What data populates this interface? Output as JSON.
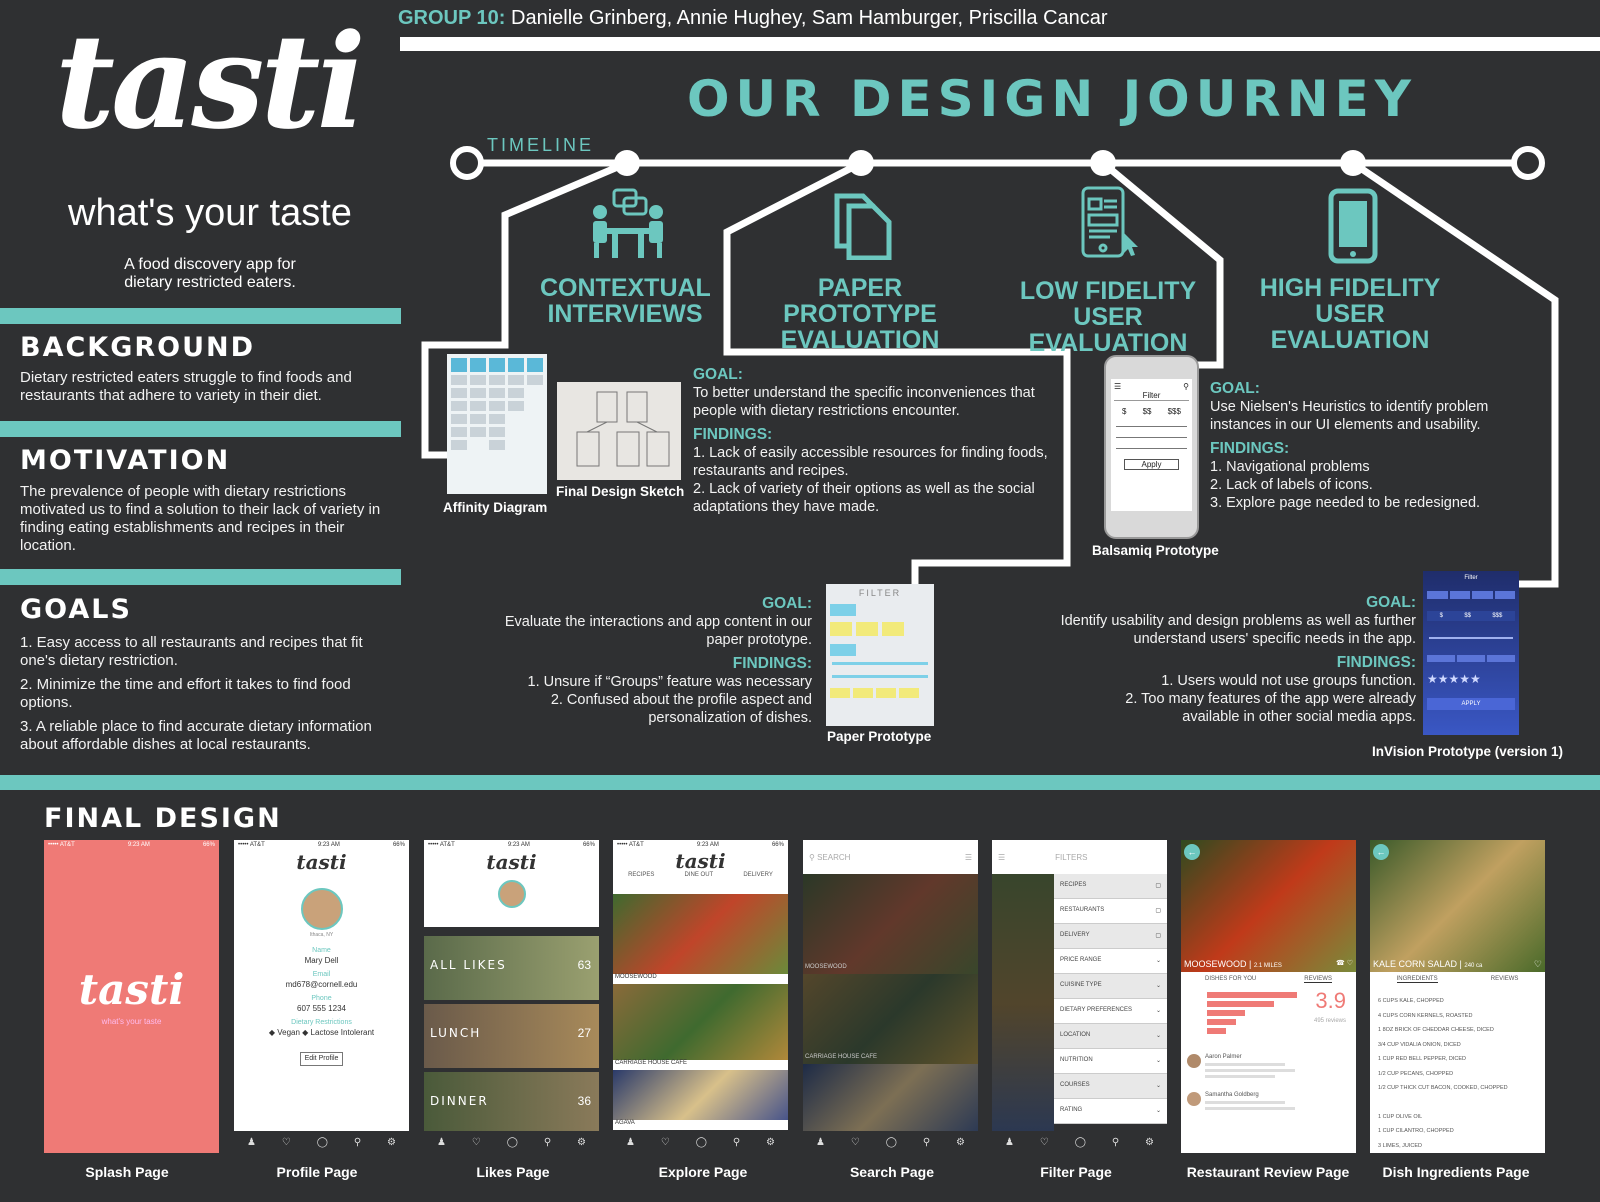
{
  "header": {
    "group_label": "GROUP 10:",
    "members": "Danielle Grinberg, Annie Hughey, Sam Hamburger, Priscilla Cancar"
  },
  "brand": {
    "logo": "tasti",
    "tagline": "what's your taste",
    "desc_line1": "A food discovery app for",
    "desc_line2": "dietary restricted eaters."
  },
  "background": {
    "title": "BACKGROUND",
    "text": "Dietary restricted eaters struggle to find foods and restaurants that adhere to variety in their diet."
  },
  "motivation": {
    "title": "MOTIVATION",
    "text": "The prevalence of people with dietary restrictions motivated us to find a solution to their lack of variety in finding eating establishments and recipes in their location."
  },
  "goals": {
    "title": "GOALS",
    "items": [
      "1. Easy access to all restaurants and recipes that fit one's dietary restriction.",
      "2. Minimize the time and effort it takes to find food options.",
      "3. A reliable place to find accurate dietary information about affordable dishes at local restaurants."
    ]
  },
  "journey": {
    "title": "OUR DESIGN JOURNEY",
    "timeline_label": "TIMELINE",
    "phases": [
      {
        "line1": "CONTEXTUAL",
        "line2": "INTERVIEWS"
      },
      {
        "line1": "PAPER PROTOTYPE",
        "line2": "EVALUATION"
      },
      {
        "line1": "LOW FIDELITY",
        "line2": "USER EVALUATION"
      },
      {
        "line1": "HIGH FIDELITY",
        "line2": "USER EVALUATION"
      }
    ]
  },
  "contextual": {
    "goal_label": "GOAL:",
    "goal": "To better understand the specific inconveniences that people with dietary restrictions encounter.",
    "findings_label": "FINDINGS:",
    "f1": "1. Lack of easily accessible resources for finding foods, restaurants and recipes.",
    "f2": "2. Lack of variety of their options as well as the social adaptations they have made.",
    "img1": "Affinity Diagram",
    "img2": "Final Design Sketch"
  },
  "paper": {
    "goal_label": "GOAL:",
    "goal": "Evaluate the interactions and app content in our paper prototype.",
    "findings_label": "FINDINGS:",
    "f1": "1. Unsure if “Groups” feature was necessary",
    "f2": "2. Confused about the profile aspect and personalization of dishes.",
    "img": "Paper Prototype",
    "sketch_title": "FILTER"
  },
  "lowfi": {
    "goal_label": "GOAL:",
    "goal": "Use Nielsen's Heuristics to identify problem instances in our UI elements and usability.",
    "findings_label": "FINDINGS:",
    "f1": "1. Navigational problems",
    "f2": "2. Lack of labels of icons.",
    "f3": "3. Explore page needed to be redesigned.",
    "img": "Balsamiq Prototype",
    "mock_filter": "Filter",
    "mock_apply": "Apply",
    "mock_prices": [
      "$",
      "$$",
      "$$$"
    ]
  },
  "hifi": {
    "goal_label": "GOAL:",
    "goal": "Identify usability and design problems as well as further understand users' specific needs in the app.",
    "findings_label": "FINDINGS:",
    "f1": "1. Users would not use groups function.",
    "f2": "2. Too many features of the app were already available in other social media apps.",
    "img": "InVision Prototype (version 1)",
    "mock_title": "Filter",
    "mock_apply": "APPLY",
    "mock_prices": [
      "$",
      "$$",
      "$$$"
    ]
  },
  "final": {
    "title": "FINAL DESIGN",
    "labels": [
      "Splash Page",
      "Profile Page",
      "Likes Page",
      "Explore Page",
      "Search Page",
      "Filter Page",
      "Restaurant Review Page",
      "Dish Ingredients Page"
    ],
    "status_time": "9:23 AM",
    "carrier": "••••• AT&T",
    "battery": "66%",
    "splash_logo": "tasti",
    "splash_tag": "what's your taste",
    "profile": {
      "location": "Ithaca, NY",
      "name_label": "Name",
      "name": "Mary Dell",
      "email_label": "Email",
      "email": "md678@cornell.edu",
      "phone_label": "Phone",
      "phone": "607 555 1234",
      "diet_label": "Dietary Restrictions",
      "diet1": "Vegan",
      "diet2": "Lactose Intolerant",
      "edit": "Edit Profile"
    },
    "likes": [
      {
        "label": "ALL LIKES",
        "count": "63"
      },
      {
        "label": "LUNCH",
        "count": "27"
      },
      {
        "label": "DINNER",
        "count": "36"
      }
    ],
    "explore_tabs": [
      "RECIPES",
      "DINE OUT",
      "DELIVERY"
    ],
    "explore_items": [
      "MOOSEWOOD",
      "CARRIAGE HOUSE CAFE",
      "AGAVA"
    ],
    "search_placeholder": "SEARCH",
    "filter_title": "FILTERS",
    "filter_items": [
      "RECIPES",
      "RESTAURANTS",
      "DELIVERY",
      "PRICE RANGE",
      "CUISINE TYPE",
      "DIETARY PREFERENCES",
      "LOCATION",
      "NUTRITION",
      "COURSES",
      "RATING"
    ],
    "review": {
      "name": "MOOSEWOOD",
      "dist": "2.1 MILES",
      "tab1": "DISHES FOR YOU",
      "tab2": "REVIEWS",
      "score": "3.9",
      "count": "495 reviews",
      "r1": "Aaron Palmer",
      "r2": "Samantha Goldberg"
    },
    "dish": {
      "name": "KALE CORN SALAD",
      "cal": "240 ca",
      "tab1": "INGREDIENTS",
      "tab2": "REVIEWS",
      "ingredients": [
        "6 CUPS KALE, CHOPPED",
        "4 CUPS CORN KERNELS, ROASTED",
        "1 8OZ BRICK OF CHEDDAR CHEESE, DICED",
        "3/4 CUP VIDALIA ONION, DICED",
        "1 CUP RED BELL PEPPER, DICED",
        "1/2 CUP PECANS, CHOPPED",
        "1/2 CUP THICK CUT BACON, COOKED, CHOPPED",
        "1 CUP OLIVE OIL",
        "1 CUP CILANTRO, CHOPPED",
        "3 LIMES, JUICED"
      ]
    },
    "nav": [
      "PROFILE",
      "LIKES",
      "EXPLORE",
      "SEARCH",
      "SETTINGS"
    ]
  },
  "colors": {
    "background": "#2f3032",
    "accent": "#6cc7bf",
    "splash": "#ef7a76"
  }
}
